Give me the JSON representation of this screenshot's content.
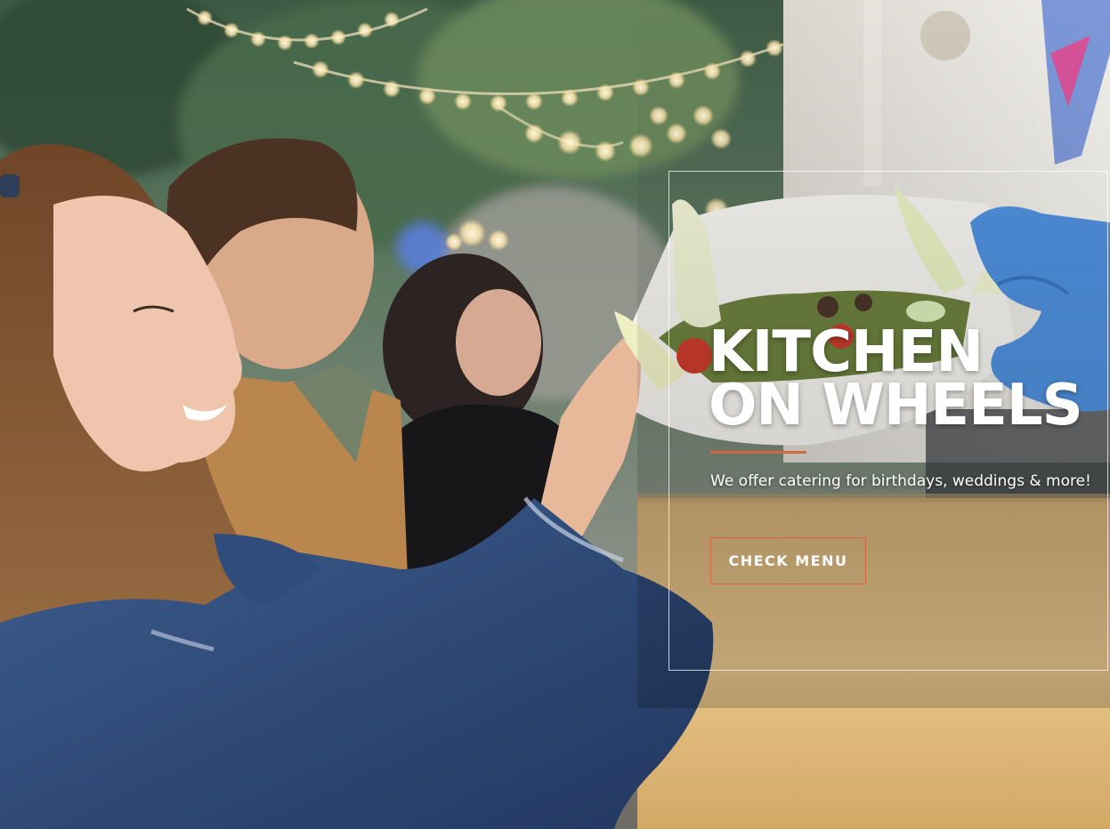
{
  "hero": {
    "title_line1": "KITCHEN",
    "title_line2": "ON WHEELS",
    "subtitle": "We offer catering for birthdays, weddings & more!",
    "cta_label": "CHECK MENU"
  },
  "colors": {
    "accent": "#d4683a",
    "text": "#ffffff"
  },
  "icons": []
}
